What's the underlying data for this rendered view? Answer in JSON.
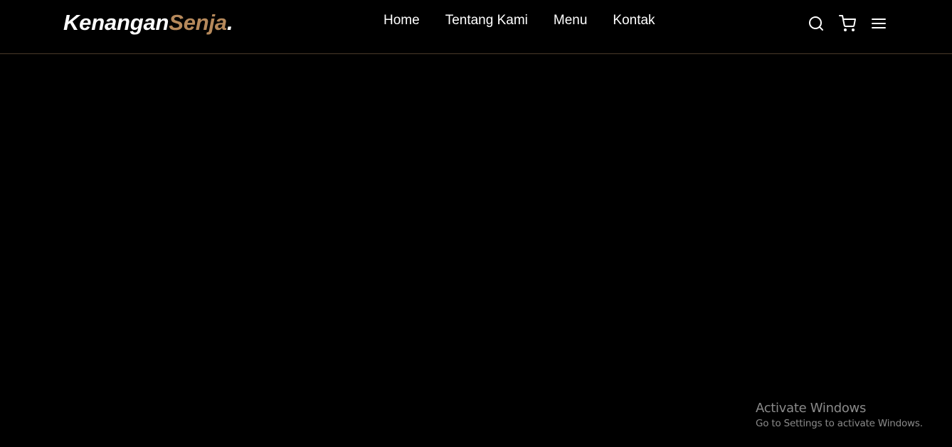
{
  "navbar": {
    "logo": {
      "text_main": "Kenangan",
      "text_accent": "Senja",
      "text_dot": ".",
      "accent_color": "#b6895b"
    },
    "links": [
      {
        "label": "Home"
      },
      {
        "label": "Tentang Kami"
      },
      {
        "label": "Menu"
      },
      {
        "label": "Kontak"
      }
    ],
    "icons": [
      "search-icon",
      "shopping-cart-icon",
      "hamburger-menu-icon"
    ]
  },
  "colors": {
    "background": "#000000",
    "text": "#ffffff",
    "accent": "#b6895b",
    "divider": "#4a3a2a"
  },
  "watermark": {
    "title": "Activate Windows",
    "subtitle": "Go to Settings to activate Windows."
  }
}
